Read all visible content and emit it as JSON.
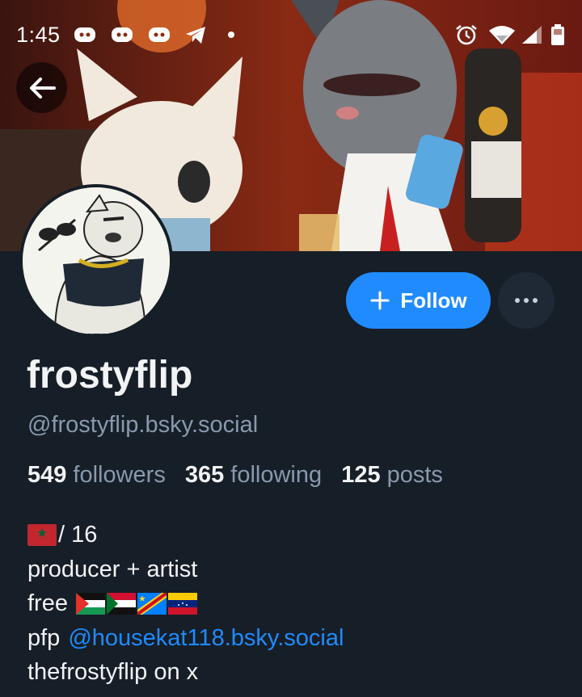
{
  "status_bar": {
    "time": "1:45",
    "left_icons": [
      "discord-icon",
      "discord-icon",
      "discord-icon",
      "telegram-icon",
      "dot-icon"
    ],
    "right_icons": [
      "alarm-icon",
      "wifi-icon",
      "signal-icon",
      "battery-icon"
    ]
  },
  "profile": {
    "display_name": "frostyflip",
    "handle": "@frostyflip.bsky.social",
    "follow_label": "Follow",
    "stats": {
      "followers_count": "549",
      "followers_label": "followers",
      "following_count": "365",
      "following_label": "following",
      "posts_count": "125",
      "posts_label": "posts"
    },
    "bio": {
      "line1_flag": "morocco-flag",
      "line1_text": "/ 16",
      "line2_text": "producer + artist",
      "line3_text": "free",
      "line3_flags": [
        "palestine-flag",
        "sudan-flag",
        "dr-congo-flag",
        "venezuela-flag"
      ],
      "line4_text": "pfp",
      "line4_link": "@housekat118.bsky.social",
      "line5_text": "thefrostyflip on x"
    }
  },
  "colors": {
    "background": "#161e27",
    "accent": "#208bfe",
    "muted_text": "#8a99ad",
    "primary_text": "#f1f3f5"
  }
}
